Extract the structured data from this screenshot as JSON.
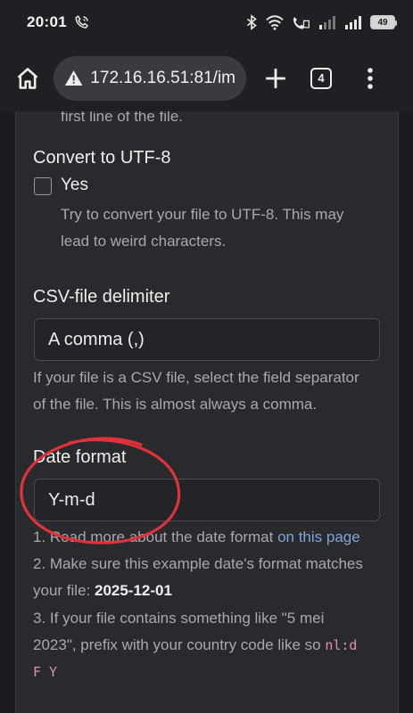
{
  "statusbar": {
    "time": "20:01",
    "battery": "49"
  },
  "browser": {
    "url": "172.16.16.51:81/im",
    "tab_count": "4"
  },
  "form": {
    "header_tail": "first line of the file.",
    "utf8": {
      "label": "Convert to UTF-8",
      "checkbox_label": "Yes",
      "help_line1": "Try to convert your file to UTF-8. This may",
      "help_line2": "lead to weird characters."
    },
    "delimiter": {
      "label": "CSV-file delimiter",
      "value": "A comma (,)",
      "help_line1": "If your file is a CSV file, select the field separator",
      "help_line2": "of the file. This is almost always a comma."
    },
    "date_format": {
      "label": "Date format",
      "value": "Y-m-d",
      "help1_prefix": "1. Read more about the date format ",
      "help1_link": "on this page",
      "help2_line1": "2. Make sure this example date's format matches",
      "help2_prefix": "your file: ",
      "help2_date": "2025-12-01",
      "help3_line1": "3. If your file contains something like \"5 mei",
      "help3_prefix": "2023\", prefix with your country code like so ",
      "help3_code1": "nl:d",
      "help3_code2": "F Y"
    }
  },
  "colors": {
    "annotation_circle": "#e0323a",
    "link": "#7ea6d8",
    "code": "#e58bb2"
  }
}
